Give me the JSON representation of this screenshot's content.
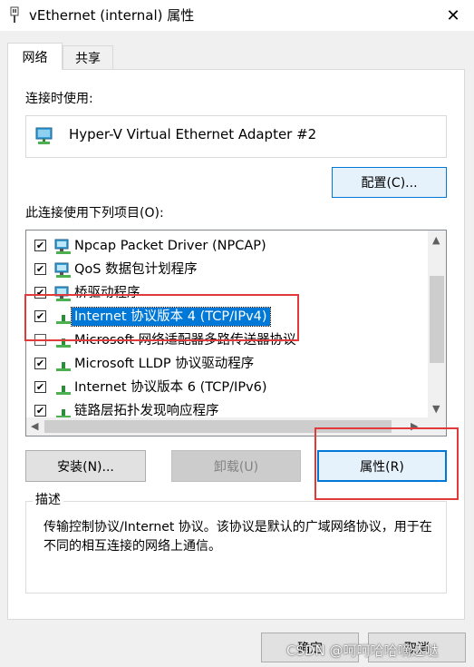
{
  "window": {
    "title": "vEthernet (internal) 属性",
    "close_glyph": "✕"
  },
  "tabs": [
    {
      "label": "网络",
      "active": true
    },
    {
      "label": "共享",
      "active": false
    }
  ],
  "connect_using": {
    "label": "连接时使用:",
    "adapter": "Hyper-V Virtual Ethernet Adapter #2",
    "configure_button": "配置(C)..."
  },
  "items_label": "此连接使用下列项目(O):",
  "items": [
    {
      "label": "Npcap Packet Driver (NPCAP)",
      "checked": true,
      "icon": "network-client-icon"
    },
    {
      "label": "QoS 数据包计划程序",
      "checked": true,
      "icon": "network-service-icon"
    },
    {
      "label": "桥驱动程序",
      "checked": true,
      "icon": "network-service-icon"
    },
    {
      "label": "Internet 协议版本 4 (TCP/IPv4)",
      "checked": true,
      "icon": "protocol-icon",
      "selected": true
    },
    {
      "label": "Microsoft 网络适配器多路传送器协议",
      "checked": false,
      "icon": "protocol-icon"
    },
    {
      "label": "Microsoft LLDP 协议驱动程序",
      "checked": true,
      "icon": "protocol-icon"
    },
    {
      "label": "Internet 协议版本 6 (TCP/IPv6)",
      "checked": true,
      "icon": "protocol-icon"
    },
    {
      "label": "链路层拓扑发现响应程序",
      "checked": true,
      "icon": "protocol-icon"
    }
  ],
  "buttons": {
    "install": "安装(N)...",
    "uninstall": "卸载(U)",
    "properties": "属性(R)"
  },
  "description": {
    "title": "描述",
    "text": "传输控制协议/Internet 协议。该协议是默认的广域网络协议，用于在不同的相互连接的网络上通信。"
  },
  "footer": {
    "ok": "确定",
    "cancel": "取消"
  },
  "watermark": "CSDN @呵呵哈哈嘀达哒",
  "colors": {
    "accent": "#0078d7",
    "highlight_box": "#e03a3a"
  }
}
